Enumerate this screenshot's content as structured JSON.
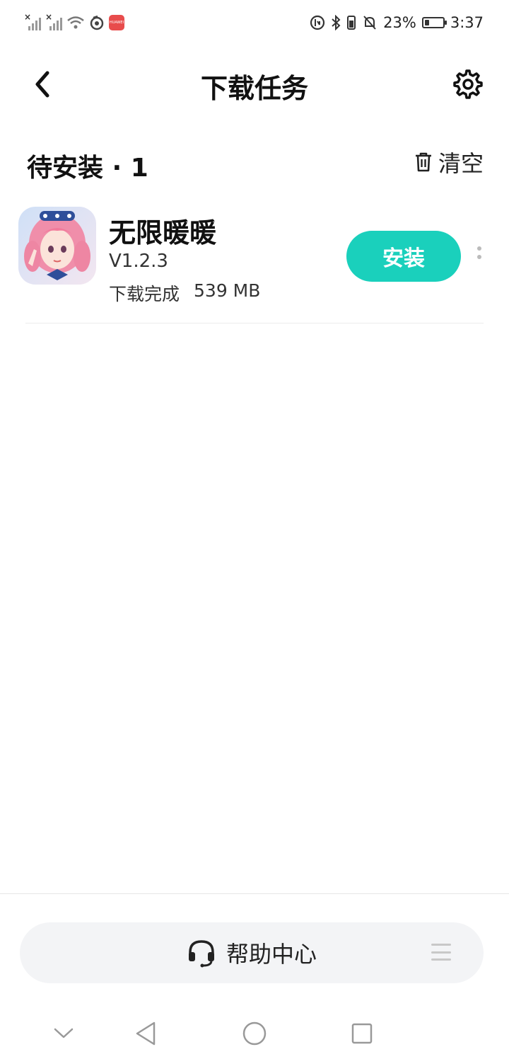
{
  "status_bar": {
    "battery_percent": "23%",
    "battery_level": 0.23,
    "time": "3:37",
    "icons": [
      "signal-icon",
      "signal-icon",
      "wifi-icon",
      "app-notification-icon",
      "huawei-badge-icon",
      "data-saver-icon",
      "bluetooth-icon",
      "vibrate-icon",
      "mute-icon",
      "battery-icon"
    ]
  },
  "header": {
    "title": "下载任务",
    "back_icon": "back-arrow-icon",
    "settings_icon": "gear-icon"
  },
  "section": {
    "title": "待安装 · 1",
    "clear_label": "清空",
    "clear_icon": "trash-icon"
  },
  "items": [
    {
      "name": "无限暖暖",
      "version": "V1.2.3",
      "status": "下载完成",
      "size": "539 MB",
      "action_label": "安装",
      "accent_color": "#1ad0bc"
    }
  ],
  "bottom": {
    "help_label": "帮助中心",
    "help_icon": "headset-icon",
    "menu_icon": "menu-icon"
  },
  "navbar": {
    "icons": [
      "collapse-icon",
      "back-triangle-icon",
      "home-circle-icon",
      "recents-square-icon"
    ]
  }
}
